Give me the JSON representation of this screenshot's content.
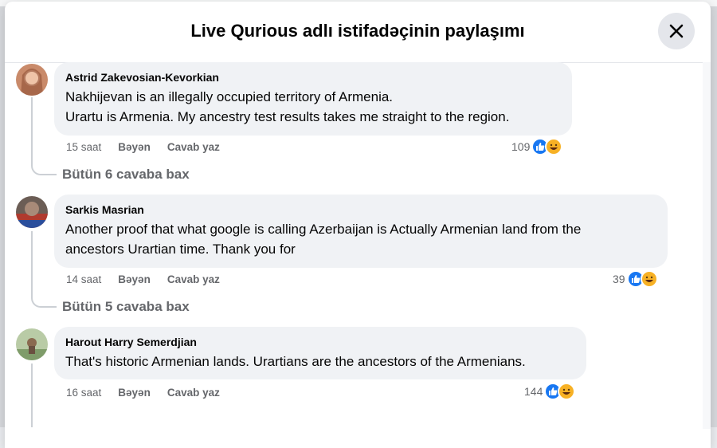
{
  "modal": {
    "title": "Live Qurious adlı istifadəçinin paylaşımı"
  },
  "comments": [
    {
      "author": "Astrid Zakevosian-Kevorkian",
      "lines": [
        "Nakhijevan is an illegally occupied territory of Armenia.",
        "Urartu is Armenia. My ancestry test results takes me straight to the region."
      ],
      "time": "15 saat",
      "like_label": "Bəyən",
      "reply_label": "Cavab yaz",
      "reaction_count": "109",
      "view_replies": "Bütün 6 cavaba bax",
      "avatar_color": "#c98a6a"
    },
    {
      "author": "Sarkis Masrian",
      "lines": [
        "Another proof that what google is calling Azerbaijan is Actually Armenian land from the",
        "ancestors Urartian time. Thank you for"
      ],
      "time": "14 saat",
      "like_label": "Bəyən",
      "reply_label": "Cavab yaz",
      "reaction_count": "39",
      "view_replies": "Bütün 5 cavaba bax",
      "avatar_color": "#7a6a60"
    },
    {
      "author": "Harout Harry Semerdjian",
      "lines": [
        "That's historic Armenian lands. Urartians are the ancestors of the Armenians."
      ],
      "time": "16 saat",
      "like_label": "Bəyən",
      "reply_label": "Cavab yaz",
      "reaction_count": "144",
      "view_replies": "",
      "avatar_color": "#9ab38a"
    }
  ],
  "icons": {
    "close": "close-icon",
    "like": "like-icon",
    "haha": "haha-icon"
  },
  "colors": {
    "like": "#1877f2",
    "haha": "#f7b125",
    "bubble": "#f0f2f5",
    "meta": "#65676b"
  }
}
